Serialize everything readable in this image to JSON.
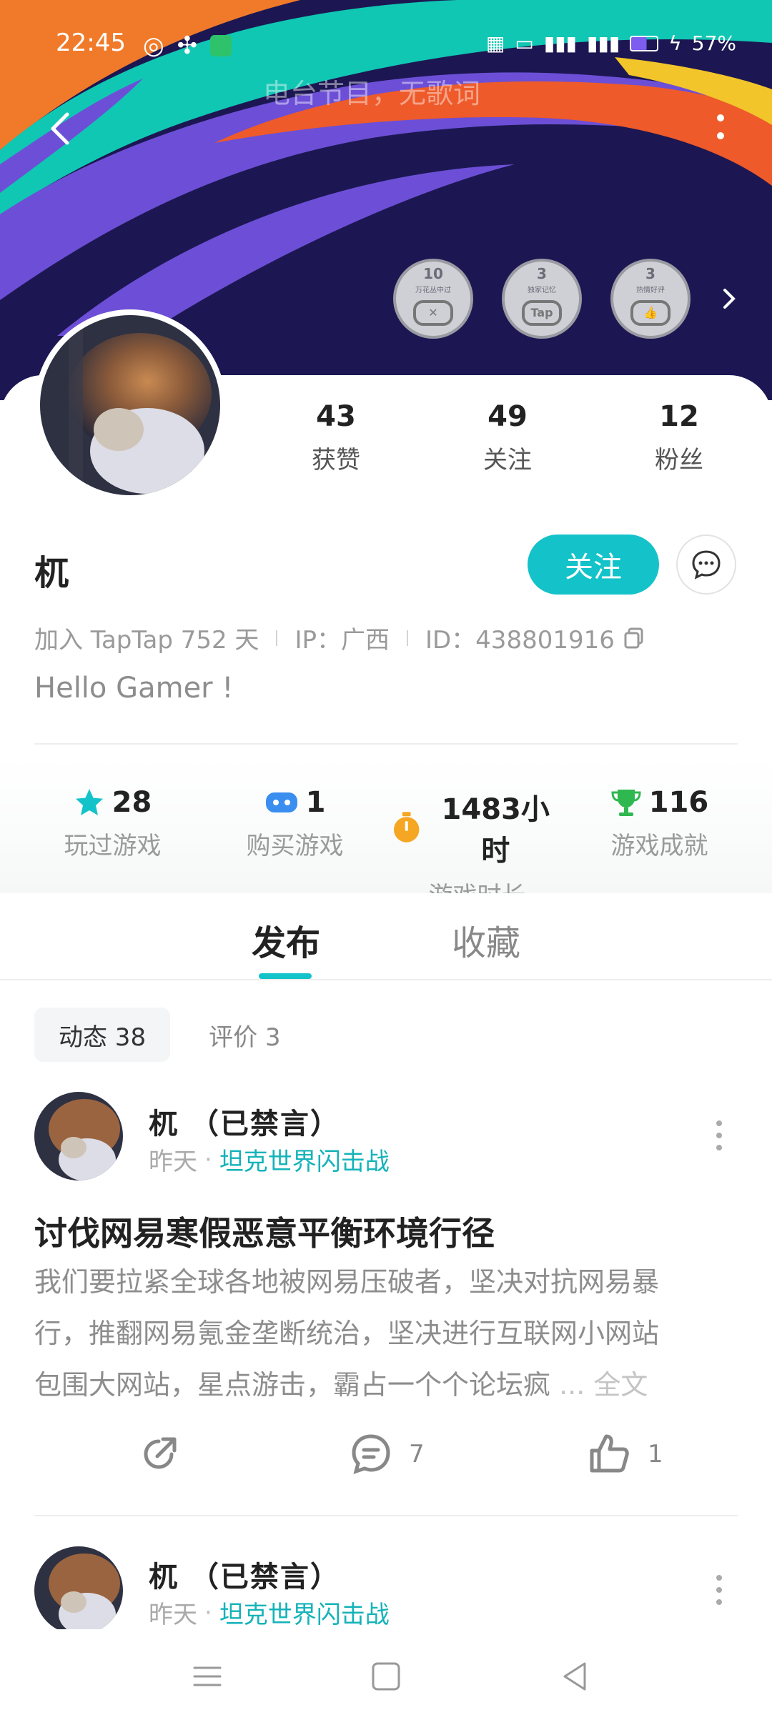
{
  "status_bar": {
    "time": "22:45",
    "right_text": "57%"
  },
  "header": {
    "now_playing": "电台节目，无歌词",
    "badges": [
      {
        "count": "10",
        "caption": "万花丛中过",
        "icon": "gamepad-icon"
      },
      {
        "count": "3",
        "caption": "独家记忆",
        "icon": "tap-icon"
      },
      {
        "count": "3",
        "caption": "热情好评",
        "icon": "thumbs-up-icon"
      }
    ]
  },
  "profile": {
    "stats": [
      {
        "value": "43",
        "label": "获赞"
      },
      {
        "value": "49",
        "label": "关注"
      },
      {
        "value": "12",
        "label": "粉丝"
      }
    ],
    "name": "杌",
    "follow_label": "关注",
    "joined": "加入 TapTap 752 天",
    "ip": "IP：广西",
    "id": "ID：438801916",
    "bio": "Hello Gamer !"
  },
  "game_stats": [
    {
      "value": "28",
      "label": "玩过游戏",
      "icon": "star-icon",
      "color": "#14c3c9"
    },
    {
      "value": "1",
      "label": "购买游戏",
      "icon": "gamepad-icon",
      "color": "#3a8ef0"
    },
    {
      "value": "1483小时",
      "label": "游戏时长",
      "icon": "timer-icon",
      "color": "#f5a623"
    },
    {
      "value": "116",
      "label": "游戏成就",
      "icon": "trophy-icon",
      "color": "#2fb84f"
    }
  ],
  "tabs": {
    "active": "发布",
    "inactive": "收藏"
  },
  "subtabs": {
    "active": "动态 38",
    "inactive": "评价 3"
  },
  "posts": [
    {
      "author": "杌 （已禁言）",
      "time": "昨天",
      "game": "坦克世界闪击战",
      "title": "讨伐网易寒假恶意平衡环境行径",
      "body_line1": "我们要拉紧全球各地被网易压破者，坚决对抗网易暴",
      "body_line2": "行，推翻网易氪金垄断统治，坚决进行互联网小网站",
      "body_line3": "包围大网站，星点游击，霸占一个个论坛疯",
      "more": " ... 全文",
      "comments": "7",
      "likes": "1"
    },
    {
      "author": "杌 （已禁言）",
      "time": "昨天",
      "game": "坦克世界闪击战"
    }
  ]
}
